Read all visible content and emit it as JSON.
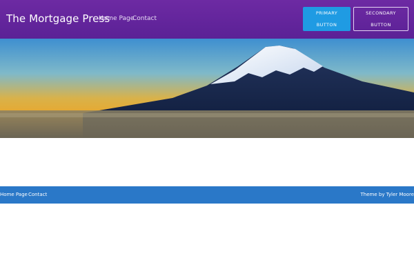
{
  "header": {
    "site_title": "The Mortgage Press",
    "nav": [
      {
        "label": "Home Page"
      },
      {
        "label": "Contact"
      }
    ],
    "primary_button": {
      "label": "PRIMARY BUTTON"
    },
    "secondary_button": {
      "label": "SECONDARY BUTTON"
    }
  },
  "hero": {
    "image": "mountain-landscape"
  },
  "footer": {
    "nav": [
      {
        "label": "Home Page"
      },
      {
        "label": "Contact"
      }
    ],
    "credit": "Theme by Tyler Moore"
  },
  "colors": {
    "header_bg": "#6d2aa3",
    "primary_button_bg": "#1f9be3",
    "footer_bg": "#2a78c8"
  }
}
